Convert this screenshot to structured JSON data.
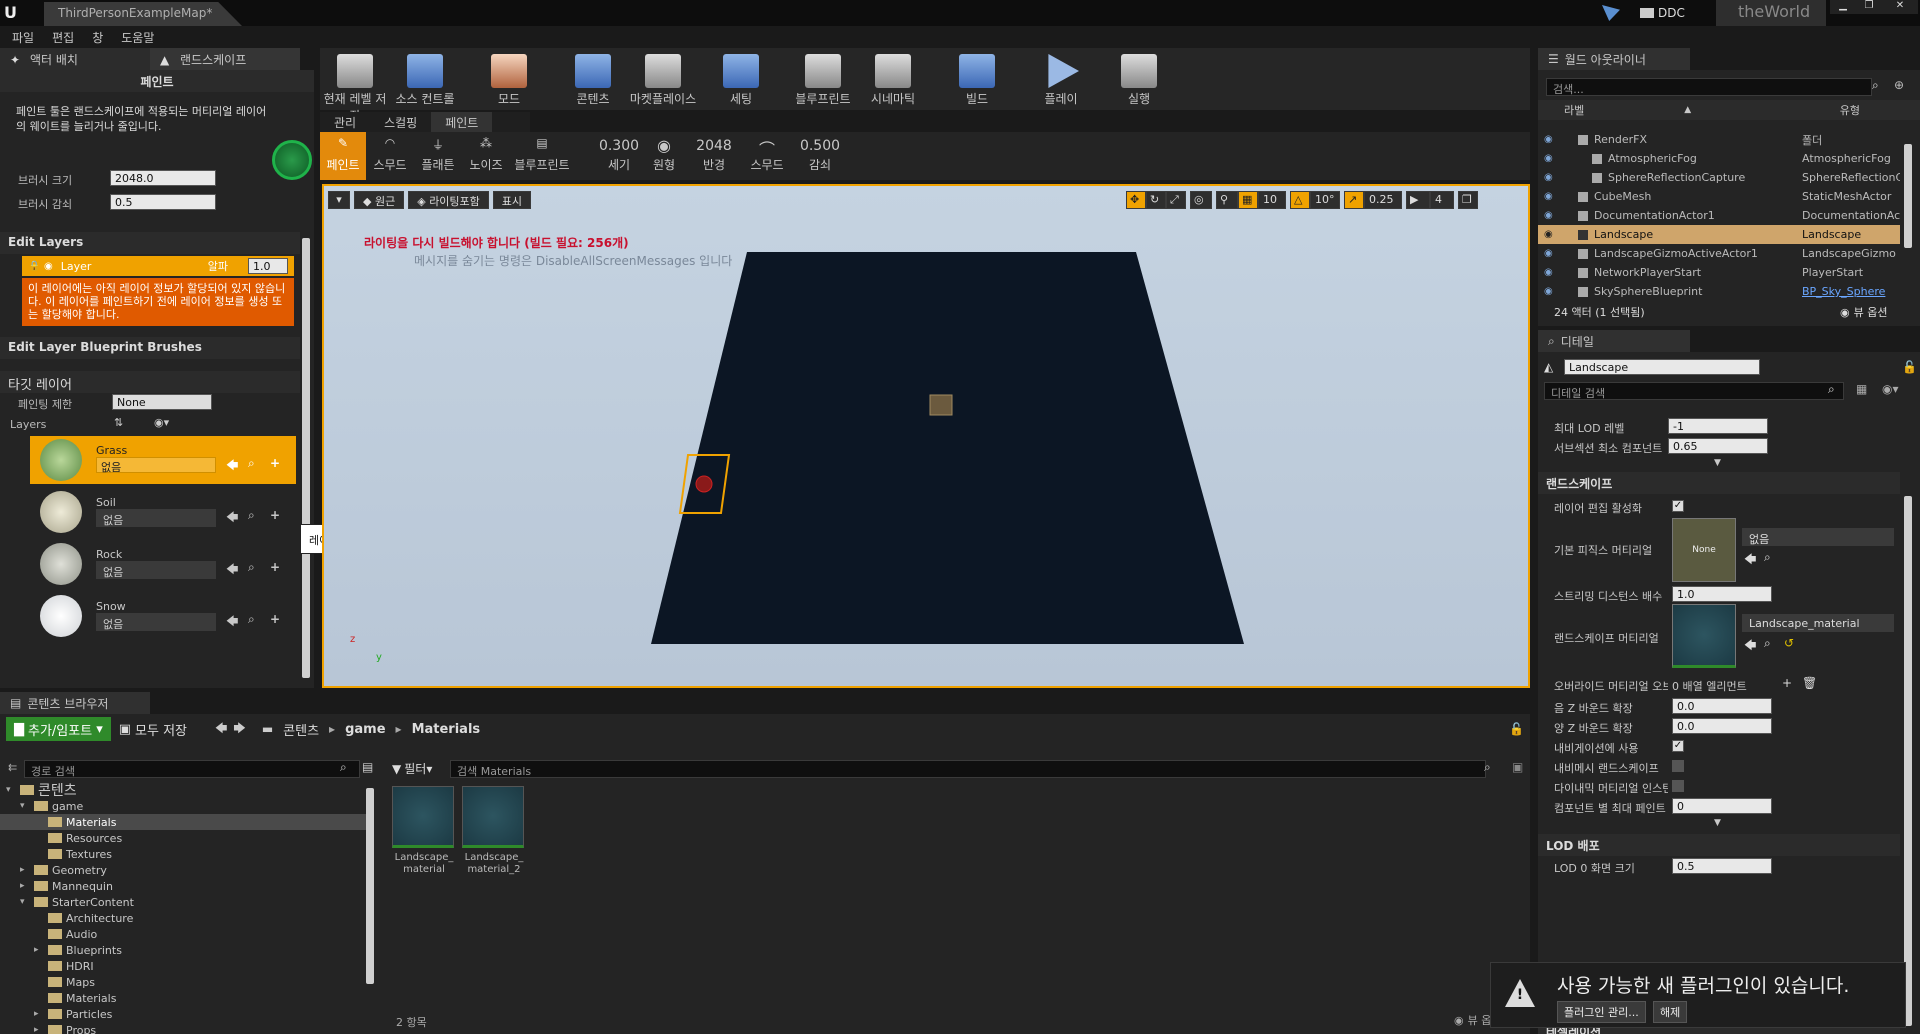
{
  "app": {
    "logo": "U",
    "doc_tab": "ThirdPersonExampleMap*",
    "ddc_label": "DDC",
    "world_label": "theWorld"
  },
  "menu": [
    "파일",
    "편집",
    "창",
    "도움말"
  ],
  "left": {
    "tabs": [
      "액터 배치",
      "랜드스케이프"
    ],
    "paint_header": "페인트",
    "paint_desc": "페인트 툴은 랜드스케이프에 적용되는 머티리얼 레이어의 웨이트를 늘리거나 줄입니다.",
    "brush_size_label": "브러시 크기",
    "brush_size_value": "2048.0",
    "brush_falloff_label": "브러시 감쇠",
    "brush_falloff_value": "0.5",
    "edit_layers": "Edit Layers",
    "layer_name": "Layer",
    "alpha_label": "알파",
    "alpha_value": "1.0",
    "layer_warning": "이 레이어에는 아직 레이어 정보가 할당되어 있지 않습니다. 이 레이어를 페인트하기 전에 레이어 정보를 생성 또는 할당해야 합니다.",
    "edit_bp_brushes": "Edit Layer Blueprint Brushes",
    "target_layer": "타깃 레이어",
    "paint_limit_label": "페인팅 제한",
    "paint_limit_value": "None",
    "layers_label": "Layers",
    "layer_items": [
      {
        "name": "Grass",
        "value": "없음"
      },
      {
        "name": "Soil",
        "value": "없음"
      },
      {
        "name": "Rock",
        "value": "없음"
      },
      {
        "name": "Snow",
        "value": "없음"
      }
    ],
    "tooltip": "레이어 인포 생성"
  },
  "toolbar": [
    {
      "label": "현재 레벨 저장"
    },
    {
      "label": "소스 컨트롤"
    },
    {
      "label": "모드"
    },
    {
      "label": "콘텐츠"
    },
    {
      "label": "마켓플레이스"
    },
    {
      "label": "세팅"
    },
    {
      "label": "블루프린트"
    },
    {
      "label": "시네마틱"
    },
    {
      "label": "빌드"
    },
    {
      "label": "플레이"
    },
    {
      "label": "실행"
    }
  ],
  "landscape_tabs": [
    "관리",
    "스컬핑",
    "페인트"
  ],
  "paint_tools": [
    "페인트",
    "스무드",
    "플래튼",
    "노이즈",
    "블루프린트"
  ],
  "paint_params": [
    {
      "value": "0.300",
      "label": "세기"
    },
    {
      "value": "",
      "label": "원형"
    },
    {
      "value": "2048",
      "label": "반경"
    },
    {
      "value": "",
      "label": "스무드"
    },
    {
      "value": "0.500",
      "label": "감쇠"
    }
  ],
  "viewport": {
    "perspective": "원근",
    "lit": "라이팅포함",
    "show": "표시",
    "grid_value": "10",
    "angle_value": "10°",
    "scale_value": "0.25",
    "cam_value": "4",
    "warning": "라이팅을 다시 빌드해야 합니다 (빌드 필요: 256개)",
    "hint": "메시지를 숨기는 명령은 DisableAllScreenMessages 입니다",
    "axis_z": "z",
    "axis_y": "y"
  },
  "content_browser": {
    "tab": "콘텐츠 브라우저",
    "add_import": "추가/임포트",
    "save_all": "모두 저장",
    "path": [
      "콘텐츠",
      "game",
      "Materials"
    ],
    "path_search": "경로 검색",
    "filter": "필터",
    "search": "검색 Materials",
    "count": "2 항목",
    "view_options": "뷰 옵션",
    "tree": [
      {
        "name": "콘텐츠",
        "depth": 0,
        "expander": "▾"
      },
      {
        "name": "game",
        "depth": 1,
        "expander": "▾"
      },
      {
        "name": "Materials",
        "depth": 2,
        "expander": ""
      },
      {
        "name": "Resources",
        "depth": 2,
        "expander": ""
      },
      {
        "name": "Textures",
        "depth": 2,
        "expander": ""
      },
      {
        "name": "Geometry",
        "depth": 1,
        "expander": "▸"
      },
      {
        "name": "Mannequin",
        "depth": 1,
        "expander": "▸"
      },
      {
        "name": "StarterContent",
        "depth": 1,
        "expander": "▾"
      },
      {
        "name": "Architecture",
        "depth": 2,
        "expander": ""
      },
      {
        "name": "Audio",
        "depth": 2,
        "expander": ""
      },
      {
        "name": "Blueprints",
        "depth": 2,
        "expander": "▸"
      },
      {
        "name": "HDRI",
        "depth": 2,
        "expander": ""
      },
      {
        "name": "Maps",
        "depth": 2,
        "expander": ""
      },
      {
        "name": "Materials",
        "depth": 2,
        "expander": ""
      },
      {
        "name": "Particles",
        "depth": 2,
        "expander": "▸"
      },
      {
        "name": "Props",
        "depth": 2,
        "expander": "▸"
      }
    ],
    "assets": [
      "Landscape_ material",
      "Landscape_ material_2"
    ]
  },
  "outliner": {
    "tab": "월드 아웃라이너",
    "search": "검색...",
    "col_label": "라벨",
    "col_type": "유형",
    "count": "24 액터 (1 선택됨)",
    "view_options": "뷰 옵션",
    "rows": [
      {
        "label": "RenderFX",
        "type": "폴더",
        "indent": 1
      },
      {
        "label": "AtmosphericFog",
        "type": "AtmosphericFog",
        "indent": 2
      },
      {
        "label": "SphereReflectionCapture",
        "type": "SphereReflectionC",
        "indent": 2
      },
      {
        "label": "CubeMesh",
        "type": "StaticMeshActor",
        "indent": 1
      },
      {
        "label": "DocumentationActor1",
        "type": "DocumentationAc",
        "indent": 1
      },
      {
        "label": "Landscape",
        "type": "Landscape",
        "indent": 1
      },
      {
        "label": "LandscapeGizmoActiveActor1",
        "type": "LandscapeGizmo",
        "indent": 1
      },
      {
        "label": "NetworkPlayerStart",
        "type": "PlayerStart",
        "indent": 1
      },
      {
        "label": "SkySphereBlueprint",
        "type": "BP_Sky_Sphere",
        "indent": 1
      }
    ]
  },
  "details": {
    "tab": "디테일",
    "name": "Landscape",
    "search": "디테일 검색",
    "max_lod_label": "최대 LOD 레벨",
    "max_lod_value": "-1",
    "min_comp_label": "서브섹션 최소 컴포넌트",
    "min_comp_value": "0.65",
    "landscape_section": "랜드스케이프",
    "layer_edit_label": "레이어 편집 활성화",
    "default_phys_label": "기본 피직스 머티리얼",
    "none_thumb": "None",
    "default_phys_value": "없음",
    "stream_label": "스트리밍 디스턴스 배수",
    "stream_value": "1.0",
    "ls_mat_label": "랜드스케이프 머티리얼",
    "ls_mat_value": "Landscape_material",
    "override_label": "오버라이드 머티리얼 오브",
    "override_value": "0 배열 엘리먼트",
    "negz_label": "음 Z 바운드 확장",
    "negz_value": "0.0",
    "posz_label": "양 Z 바운드 확장",
    "posz_value": "0.0",
    "nav_label": "내비게이션에 사용",
    "navmesh_label": "내비메시 랜드스케이프",
    "dyn_label": "다이내믹 머티리얼 인스턴",
    "maxpaint_label": "컴포넌트 별 최대 페인트",
    "maxpaint_value": "0",
    "lod_section": "LOD 배포",
    "lod0_label": "LOD 0 화면 크기",
    "lod0_value": "0.5",
    "tess_section": "테셀레이션"
  },
  "notify": {
    "text": "사용 가능한 새 플러그인이 있습니다.",
    "manage": "플러그인 관리...",
    "dismiss": "해제"
  }
}
